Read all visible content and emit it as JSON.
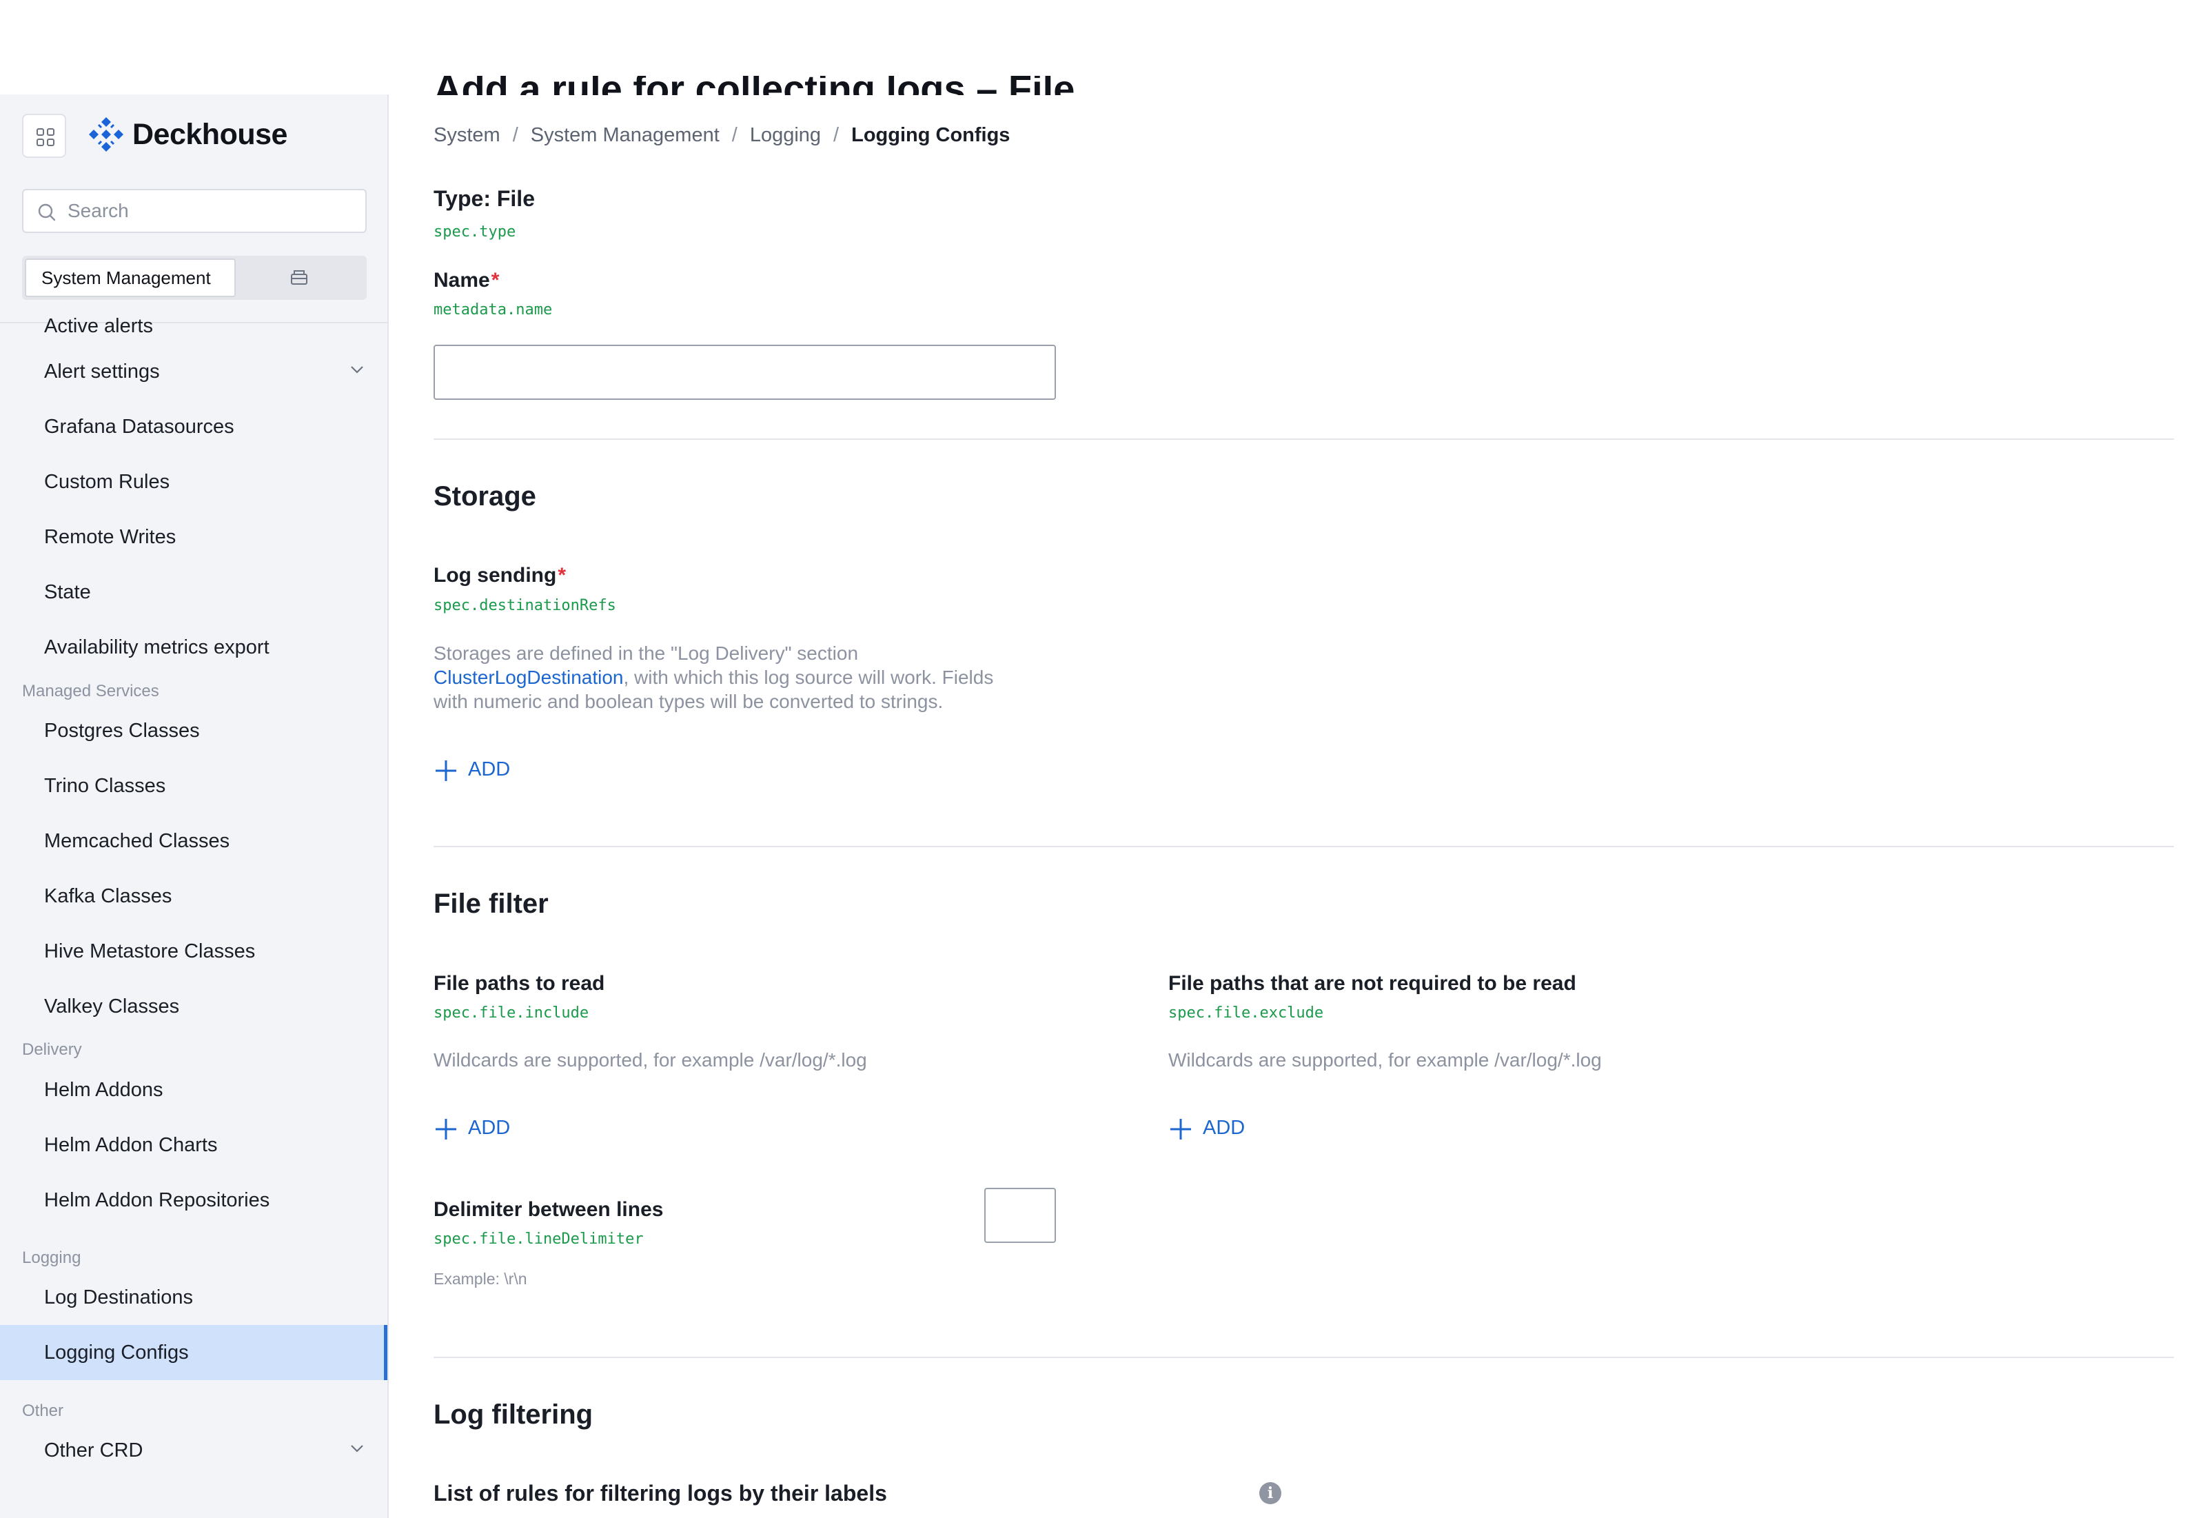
{
  "app": {
    "brand": "Deckhouse"
  },
  "sidebar": {
    "search_placeholder": "Search",
    "segment_active": "System Management",
    "items": [
      {
        "label": "Active alerts"
      },
      {
        "label": "Alert settings"
      },
      {
        "label": "Grafana Datasources"
      },
      {
        "label": "Custom Rules"
      },
      {
        "label": "Remote Writes"
      },
      {
        "label": "State"
      },
      {
        "label": "Availability metrics export"
      }
    ],
    "groups": {
      "managed": {
        "title": "Managed Services",
        "items": [
          "Postgres Classes",
          "Trino Classes",
          "Memcached Classes",
          "Kafka Classes",
          "Hive Metastore Classes",
          "Valkey Classes"
        ]
      },
      "delivery": {
        "title": "Delivery",
        "items": [
          "Helm Addons",
          "Helm Addon Charts",
          "Helm Addon Repositories"
        ]
      },
      "logging": {
        "title": "Logging",
        "items": [
          "Log Destinations",
          "Logging Configs"
        ]
      },
      "other": {
        "title": "Other",
        "items": [
          "Other CRD"
        ]
      }
    },
    "active_item": "Logging Configs"
  },
  "page": {
    "title_partial": "Add a rule for collecting logs – File",
    "breadcrumb": [
      "System",
      "System Management",
      "Logging",
      "Logging Configs"
    ],
    "breadcrumb_sep": "/"
  },
  "form": {
    "type": {
      "label": "Type: File",
      "path": "spec.type"
    },
    "name": {
      "label": "Name",
      "required": "*",
      "path": "metadata.name",
      "value": ""
    },
    "storage": {
      "title": "Storage",
      "log_sending": {
        "label": "Log sending",
        "required": "*",
        "path": "spec.destinationRefs"
      },
      "help_line1": "Storages are defined in the \"Log Delivery\" section",
      "help_link": "ClusterLogDestination",
      "help_line2_rest": ", with which this log source will work. Fields",
      "help_line3": "with numeric and boolean types will be converted to strings.",
      "add": "ADD"
    },
    "file_filter": {
      "title": "File filter",
      "include": {
        "label": "File paths to read",
        "path": "spec.file.include",
        "help": "Wildcards are supported, for example /var/log/*.log",
        "add": "ADD"
      },
      "exclude": {
        "label": "File paths that are not required to be read",
        "path": "spec.file.exclude",
        "help": "Wildcards are supported, for example /var/log/*.log",
        "add": "ADD"
      },
      "delimiter": {
        "label": "Delimiter between lines",
        "path": "spec.file.lineDelimiter",
        "example": "Example: \\r\\n",
        "value": ""
      }
    },
    "log_filtering": {
      "title": "Log filtering",
      "rules_label": "List of rules for filtering logs by their labels",
      "info_glyph": "i"
    }
  },
  "colors": {
    "accent": "#1c66cf",
    "active_bg": "#d0e1fb",
    "code": "#1a9a4a",
    "required": "#e0323a"
  }
}
